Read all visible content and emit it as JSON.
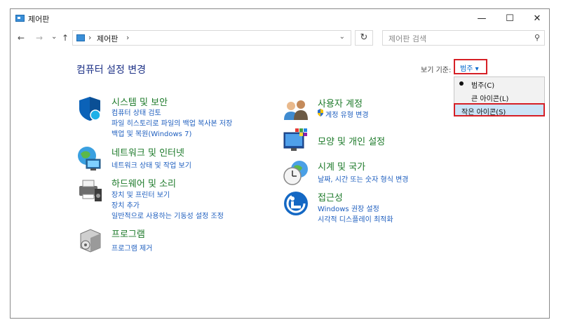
{
  "window": {
    "title": "제어판",
    "minimize": "—",
    "maximize": "☐",
    "close": "✕"
  },
  "addressbar": {
    "back": "←",
    "forward": "→",
    "recent": "⌄",
    "up": "↑",
    "sep1": "›",
    "path": "제어판",
    "sep2": "›",
    "dropdown": "⌄",
    "refresh": "↻",
    "search_placeholder": "제어판 검색",
    "search_icon": "⚲"
  },
  "main": {
    "heading": "컴퓨터 설정 변경",
    "view_by_label": "보기 기준:",
    "view_by_value": "범주 ▾"
  },
  "view_menu": {
    "items": [
      {
        "label": "범주(C)",
        "selected": true
      },
      {
        "label": "큰 아이콘(L)",
        "selected": false
      },
      {
        "label": "작은 아이콘(S)",
        "selected": false,
        "highlighted": true
      }
    ]
  },
  "categories": {
    "system": {
      "title": "시스템 및 보안",
      "links": [
        "컴퓨터 상태 검토",
        "파일 히스토리로 파일의 백업 복사본 저장",
        "백업 및 복원(Windows 7)"
      ],
      "icon": "shield-icon"
    },
    "network": {
      "title": "네트워크 및 인터넷",
      "links": [
        "네트워크 상태 및 작업 보기"
      ],
      "icon": "globe-network-icon"
    },
    "hardware": {
      "title": "하드웨어 및 소리",
      "links": [
        "장치 및 프린터 보기",
        "장치 추가",
        "일반적으로 사용하는 기동성 설정 조정"
      ],
      "icon": "printer-speaker-icon"
    },
    "programs": {
      "title": "프로그램",
      "links": [
        "프로그램 제거"
      ],
      "icon": "program-box-icon"
    },
    "users": {
      "title": "사용자 계정",
      "links": [
        "계정 유형 변경"
      ],
      "icon": "users-icon"
    },
    "appearance": {
      "title": "모양 및 개인 설정",
      "links": [],
      "icon": "monitor-palette-icon"
    },
    "clock": {
      "title": "시계 및 국가",
      "links": [
        "날짜, 시간 또는 숫자 형식 변경"
      ],
      "icon": "clock-globe-icon"
    },
    "access": {
      "title": "접근성",
      "links": [
        "Windows 권장 설정",
        "시각적 디스플레이 최적화"
      ],
      "icon": "accessibility-icon"
    }
  },
  "colors": {
    "category_title": "#1d7a2a",
    "link": "#1f5fbf",
    "heading": "#1e3287",
    "highlight_border": "#d62026",
    "menu_selected": "#cce4f7"
  }
}
